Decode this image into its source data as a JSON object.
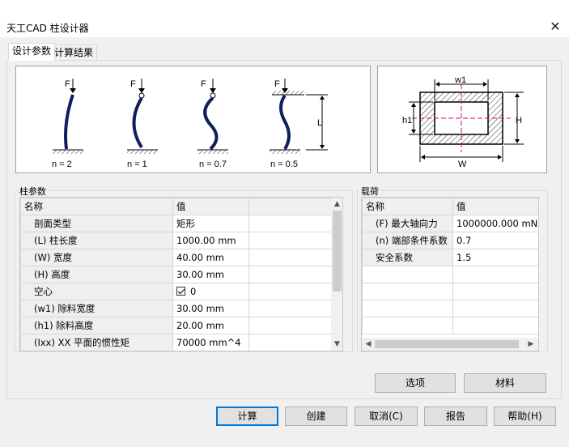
{
  "window": {
    "title": "天工CAD 柱设计器",
    "close_glyph": "✕"
  },
  "tabs": [
    {
      "label": "设计参数",
      "active": true
    },
    {
      "label": "计算结果",
      "active": false
    }
  ],
  "columns_figure": {
    "force_label": "F",
    "length_label": "L",
    "captions": [
      "n = 2",
      "n = 1",
      "n = 0.7",
      "n = 0.5"
    ]
  },
  "section_figure": {
    "w1": "w1",
    "h1": "h1",
    "H": "H",
    "W": "W"
  },
  "column_params": {
    "group_label": "柱参数",
    "headers": [
      "名称",
      "值"
    ],
    "rows": [
      {
        "name": "剖面类型",
        "value": "矩形"
      },
      {
        "name": "(L) 柱长度",
        "value": "1000.00 mm"
      },
      {
        "name": "(W) 宽度",
        "value": "40.00 mm"
      },
      {
        "name": "(H) 高度",
        "value": "30.00 mm"
      },
      {
        "name": "空心",
        "value": "0",
        "checked": true
      },
      {
        "name": "(w1) 除料宽度",
        "value": "30.00 mm"
      },
      {
        "name": "(h1) 除料高度",
        "value": "20.00 mm"
      },
      {
        "name": "(Ixx) XX 平面的惯性矩",
        "value": "70000 mm^4"
      }
    ],
    "scroll_up": "▲",
    "scroll_down": "▼"
  },
  "load": {
    "group_label": "载荷",
    "headers": [
      "名称",
      "值"
    ],
    "rows": [
      {
        "name": "(F) 最大轴向力",
        "value": "1000000.000 mN"
      },
      {
        "name": "(n) 端部条件系数",
        "value": "0.7"
      },
      {
        "name": "安全系数",
        "value": "1.5"
      }
    ],
    "scroll_left": "◀",
    "scroll_right": "▶"
  },
  "panel_buttons": {
    "options": "选项",
    "material": "材料"
  },
  "footer_buttons": {
    "calculate": "计算",
    "create": "创建",
    "cancel": "取消(C)",
    "report": "报告",
    "help": "帮助(H)"
  },
  "colors": {
    "accent": "#0078d7",
    "column_stroke": "#0f1f5c",
    "section_center_line": "#e0007a"
  }
}
